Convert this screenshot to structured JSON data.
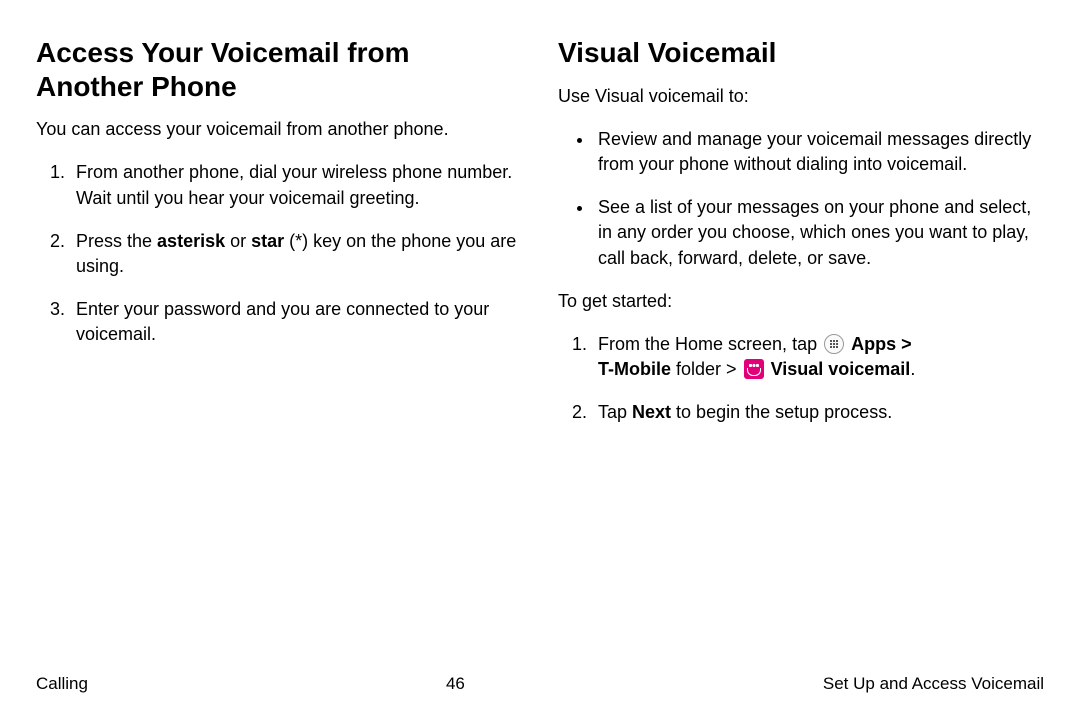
{
  "left": {
    "heading": "Access Your Voicemail from Another Phone",
    "intro": "You can access your voicemail from another phone.",
    "steps": [
      "From another phone, dial your wireless phone number. Wait until you hear your voicemail greeting.",
      {
        "pre": "Press the ",
        "b1": "asterisk",
        "mid": " or ",
        "b2": "star",
        "post": " (*) key on the phone you are using."
      },
      "Enter your password and you are connected to your voicemail."
    ]
  },
  "right": {
    "heading": "Visual Voicemail",
    "intro": "Use Visual voicemail to:",
    "bullets": [
      "Review and manage your voicemail messages directly from your phone without dialing into voicemail.",
      "See a list of your messages on your phone and select, in any order you choose, which ones you want to play, call back, forward, delete, or save."
    ],
    "started_label": "To get started:",
    "step1": {
      "pre": "From the Home screen, tap ",
      "apps": "Apps",
      "sep": " > ",
      "tmobile": "T-Mobile",
      "folder": " folder > ",
      "vvm": "Visual voicemail",
      "end": "."
    },
    "step2": {
      "pre": "Tap ",
      "b": "Next",
      "post": " to begin the setup process."
    }
  },
  "footer": {
    "left": "Calling",
    "center": "46",
    "right": "Set Up and Access Voicemail"
  }
}
